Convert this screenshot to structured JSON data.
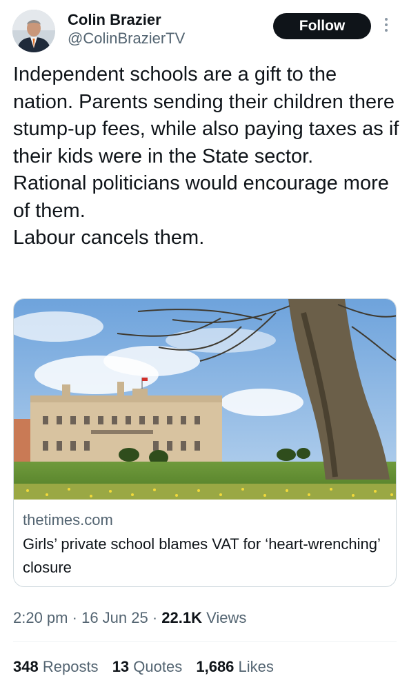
{
  "author": {
    "display_name": "Colin Brazier",
    "handle": "@ColinBrazierTV"
  },
  "follow_label": "Follow",
  "tweet_lines": [
    "Independent schools are a gift to the nation. Parents sending their children there stump-up fees, while also paying taxes as if their kids were in the State sector.",
    "Rational politicians would encourage more of them.",
    "Labour cancels them."
  ],
  "link_card": {
    "domain": "thetimes.com",
    "title": "Girls’ private school blames VAT for ‘heart-wrenching’ closure"
  },
  "meta": {
    "time": "2:20 pm",
    "separator": "·",
    "date": "16 Jun 25",
    "views_count": "22.1K",
    "views_label": "Views"
  },
  "stats": {
    "reposts_count": "348",
    "reposts_label": "Reposts",
    "quotes_count": "13",
    "quotes_label": "Quotes",
    "likes_count": "1,686",
    "likes_label": "Likes"
  },
  "icons": {
    "avatar": "avatar",
    "more": "more-vertical-icon"
  },
  "colors": {
    "text_primary": "#0f1419",
    "text_secondary": "#536471",
    "follow_button_bg": "#0f1419",
    "border": "#cfd9de"
  }
}
